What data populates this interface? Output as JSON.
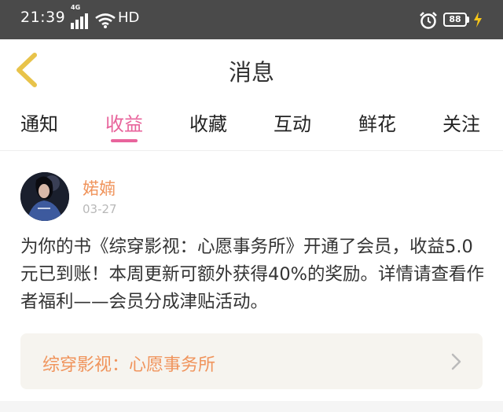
{
  "status_bar": {
    "time": "21:39",
    "network": "4G",
    "hd": "HD",
    "battery": "88",
    "icons": [
      "signal-icon",
      "wifi-icon",
      "alarm-icon",
      "battery-icon",
      "charging-icon"
    ]
  },
  "header": {
    "title": "消息",
    "back_icon": "chevron-left-icon",
    "accent_color": "#e8c34a"
  },
  "tabs": [
    {
      "label": "通知",
      "active": false
    },
    {
      "label": "收益",
      "active": true
    },
    {
      "label": "收藏",
      "active": false
    },
    {
      "label": "互动",
      "active": false
    },
    {
      "label": "鲜花",
      "active": false
    },
    {
      "label": "关注",
      "active": false
    }
  ],
  "active_tab_color": "#e8649c",
  "message": {
    "username": "婼婻",
    "date": "03-27",
    "body": "为你的书《综穿影视：心愿事务所》开通了会员，收益5.0元已到账！本周更新可额外获得40%的奖励。详情请查看作者福利——会员分成津贴活动。",
    "book_title": "综穿影视：心愿事务所",
    "link_icon": "chevron-right-icon",
    "highlight_color": "#f0945c"
  }
}
